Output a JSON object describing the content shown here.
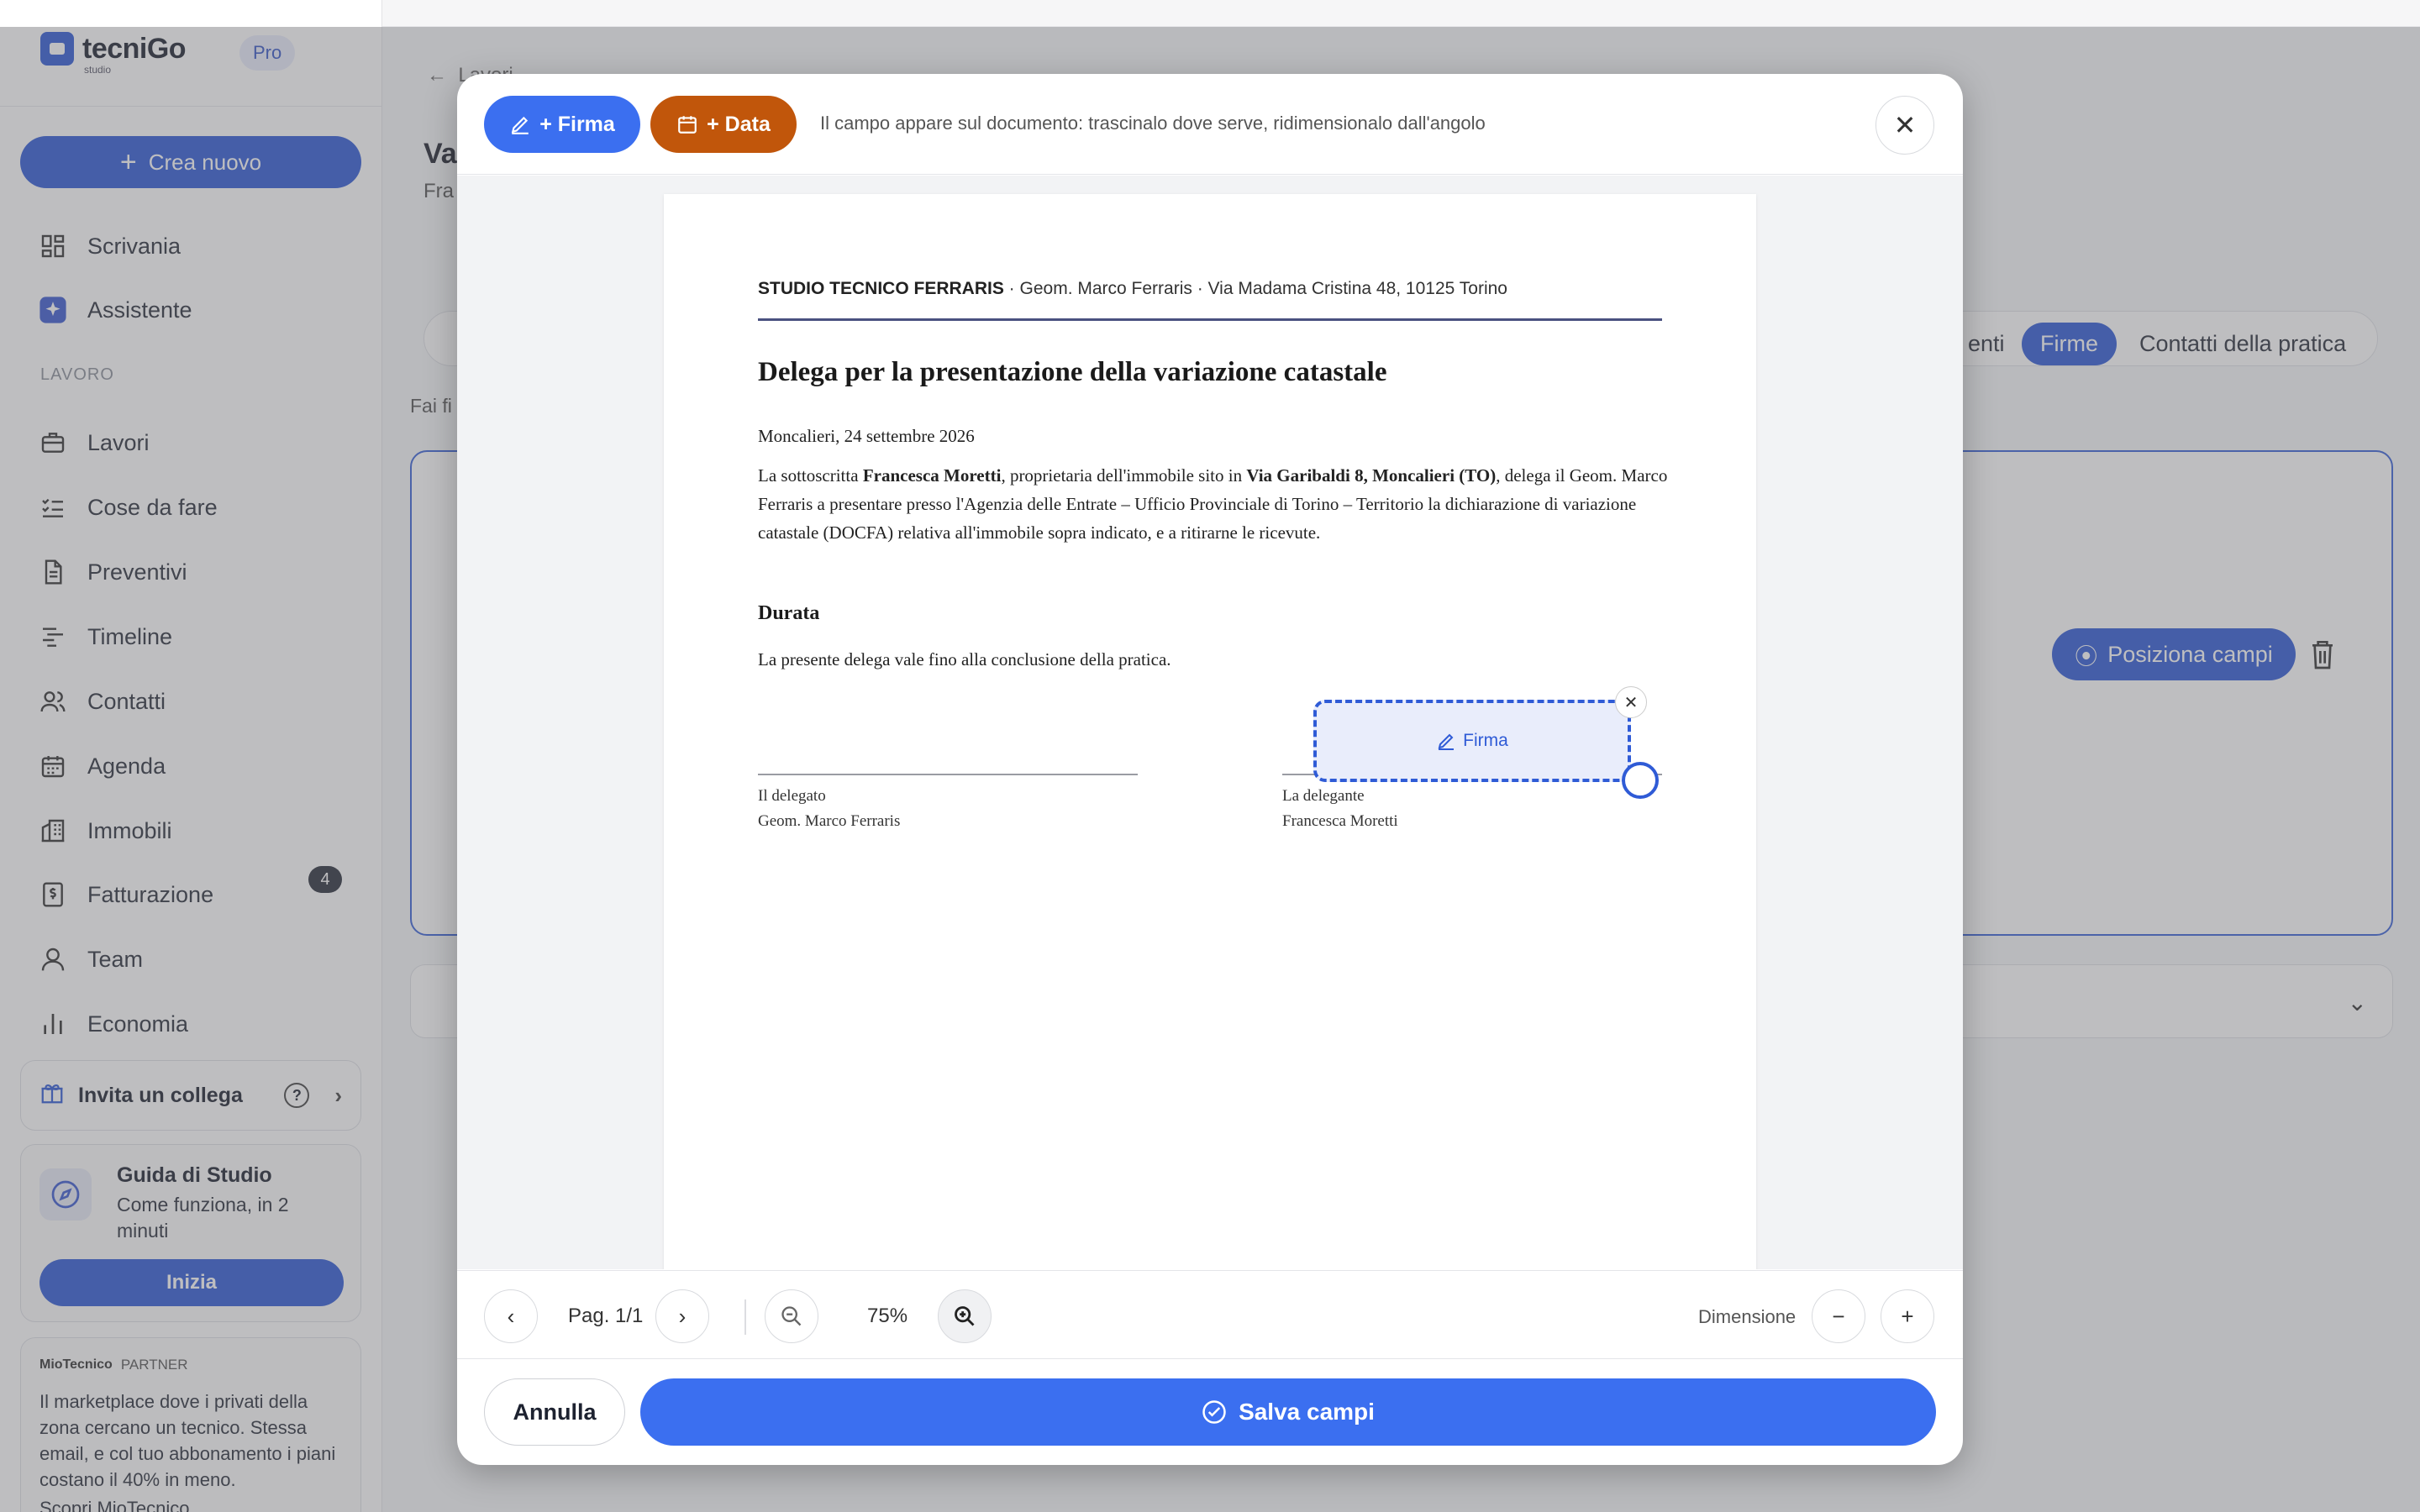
{
  "sidebar": {
    "brand": {
      "name": "tecniGo",
      "sub": "studio",
      "plan": "Pro"
    },
    "create_label": "Crea nuovo",
    "items_top": [
      {
        "label": "Scrivania",
        "icon": "dashboard-icon"
      },
      {
        "label": "Assistente",
        "icon": "sparkle-icon"
      }
    ],
    "section_label": "LAVORO",
    "items": [
      {
        "label": "Lavori",
        "icon": "briefcase-icon"
      },
      {
        "label": "Cose da fare",
        "icon": "checklist-icon"
      },
      {
        "label": "Preventivi",
        "icon": "document-icon"
      },
      {
        "label": "Timeline",
        "icon": "timeline-icon"
      },
      {
        "label": "Contatti",
        "icon": "users-icon"
      },
      {
        "label": "Agenda",
        "icon": "calendar-icon"
      },
      {
        "label": "Immobili",
        "icon": "building-icon"
      },
      {
        "label": "Fatturazione",
        "icon": "invoice-icon",
        "badge": "4"
      },
      {
        "label": "Team",
        "icon": "team-icon"
      },
      {
        "label": "Economia",
        "icon": "bar-chart-icon"
      }
    ],
    "invite_label": "Invita un collega",
    "guide": {
      "title": "Guida di Studio",
      "subtitle": "Come funziona, in 2 minuti",
      "button": "Inizia"
    },
    "partner": {
      "brand": "MioTecnico",
      "tag": "PARTNER",
      "text": "Il marketplace dove i privati della zona cercano un tecnico. Stessa email, e col tuo abbonamento i piani costano il 40% in meno.",
      "link": "Scopri MioTecnico"
    }
  },
  "main": {
    "back_label": "Lavori",
    "title_partial": "Va",
    "subtitle_partial": "Fra",
    "hint_partial": "Fai fi",
    "tabs": [
      {
        "label": "enti",
        "active": false
      },
      {
        "label": "Firme",
        "active": true
      },
      {
        "label": "Contatti della pratica",
        "active": false
      }
    ],
    "position_fields_label": "Posiziona campi"
  },
  "modal": {
    "add_signature_label": "+ Firma",
    "add_date_label": "+ Data",
    "hint": "Il campo appare sul documento: trascinalo dove serve, ridimensionalo dall'angolo",
    "document": {
      "header_bold": "STUDIO TECNICO FERRARIS",
      "header_rest": " · Geom. Marco Ferraris · Via Madama Cristina 48, 10125 Torino",
      "title": "Delega per la presentazione della variazione catastale",
      "date_line": "Moncalieri, 24 settembre 2026",
      "body_1": "La sottoscritta ",
      "body_name": "Francesca Moretti",
      "body_2": ", proprietaria dell'immobile sito in ",
      "body_address": "Via Garibaldi 8, Moncalieri (TO)",
      "body_3": ", delega il Geom. Marco Ferraris a presentare presso l'Agenzia delle Entrate – Ufficio Provinciale di Torino – Territorio la dichiarazione di variazione catastale (DOCFA) relativa all'immobile sopra indicato, e a ritirarne le ricevute.",
      "section_title": "Durata",
      "section_text": "La presente delega vale fino alla conclusione della pratica.",
      "sign_left_role": "Il delegato",
      "sign_left_name": "Geom. Marco Ferraris",
      "sign_right_role": "La delegante",
      "sign_right_name": "Francesca Moretti",
      "field_label": "Firma"
    },
    "toolbar": {
      "page_label": "Pag. 1/1",
      "zoom": "75%",
      "size_label": "Dimensione"
    },
    "cancel_label": "Annulla",
    "save_label": "Salva campi"
  },
  "colors": {
    "accent": "#2f5bd6",
    "button_blue": "#3b6ff0",
    "date_orange": "#c1560b"
  }
}
